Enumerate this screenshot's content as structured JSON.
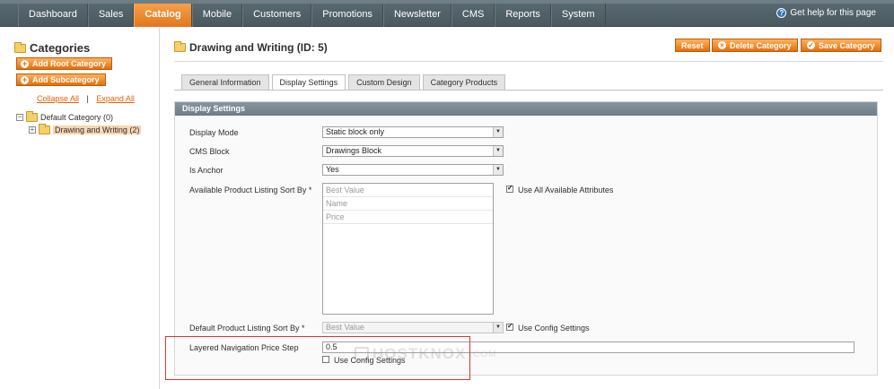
{
  "nav": {
    "items": [
      {
        "label": "Dashboard"
      },
      {
        "label": "Sales"
      },
      {
        "label": "Catalog",
        "active": true
      },
      {
        "label": "Mobile"
      },
      {
        "label": "Customers"
      },
      {
        "label": "Promotions"
      },
      {
        "label": "Newsletter"
      },
      {
        "label": "CMS"
      },
      {
        "label": "Reports"
      },
      {
        "label": "System"
      }
    ],
    "help": "Get help for this page"
  },
  "sidebar": {
    "title": "Categories",
    "add_root": "Add Root Category",
    "add_sub": "Add Subcategory",
    "collapse_all": "Collapse All",
    "separator": "|",
    "expand_all": "Expand All",
    "tree": {
      "root": "Default Category (0)",
      "child": "Drawing and Writing (2)"
    }
  },
  "header": {
    "title": "Drawing and Writing (ID: 5)",
    "reset": "Reset",
    "delete": "Delete Category",
    "save": "Save Category"
  },
  "tabs": [
    {
      "label": "General Information"
    },
    {
      "label": "Display Settings",
      "active": true
    },
    {
      "label": "Custom Design"
    },
    {
      "label": "Category Products"
    }
  ],
  "section": {
    "title": "Display Settings",
    "display_mode": {
      "label": "Display Mode",
      "value": "Static block only"
    },
    "cms_block": {
      "label": "CMS Block",
      "value": "Drawings Block"
    },
    "is_anchor": {
      "label": "Is Anchor",
      "value": "Yes"
    },
    "sort_by": {
      "label": "Available Product Listing Sort By *",
      "options": [
        "Best Value",
        "Name",
        "Price"
      ],
      "use_all_label": "Use All Available Attributes",
      "use_all_checked": true
    },
    "default_sort": {
      "label": "Default Product Listing Sort By *",
      "value": "Best Value",
      "use_config_label": "Use Config Settings",
      "use_config_checked": true
    },
    "price_step": {
      "label": "Layered Navigation Price Step",
      "value": "0.5",
      "use_config_label": "Use Config Settings",
      "use_config_checked": false
    }
  },
  "watermark": {
    "brand": "HOSTKNOX",
    "suffix": ".COM"
  },
  "colors": {
    "accent": "#e56e0a",
    "nav": "#4a5960",
    "highlight": "#e03232"
  }
}
